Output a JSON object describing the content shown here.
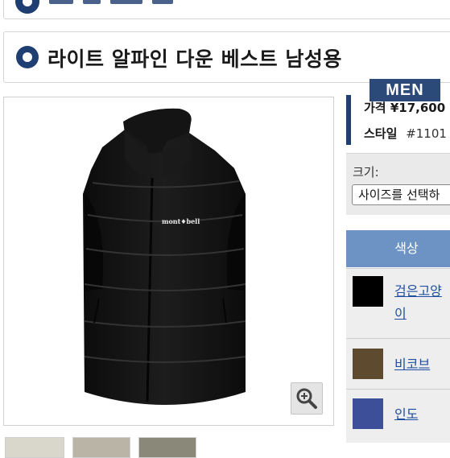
{
  "product": {
    "title": "라이트 알파인 다운 베스트 남성용",
    "badge": "MEN",
    "price": "가격 ¥17,600",
    "style_label": "스타일",
    "style_value": "#1101"
  },
  "garment_logo": "mont♦bell",
  "size": {
    "label": "크기:",
    "select_value": "사이즈를 선택하"
  },
  "colors": {
    "header": "색상",
    "items": [
      {
        "name_line1": "검은고양",
        "name_line2": "이",
        "hex": "#000000"
      },
      {
        "name_line1": "비코브",
        "hex": "#5e4a2e"
      },
      {
        "name_line1": "인도",
        "hex": "#3d4f98"
      }
    ]
  },
  "palette": {
    "brand_navy": "#1f3e72",
    "color_header_bg": "#6d93c4",
    "link_blue": "#1e4ea0"
  }
}
